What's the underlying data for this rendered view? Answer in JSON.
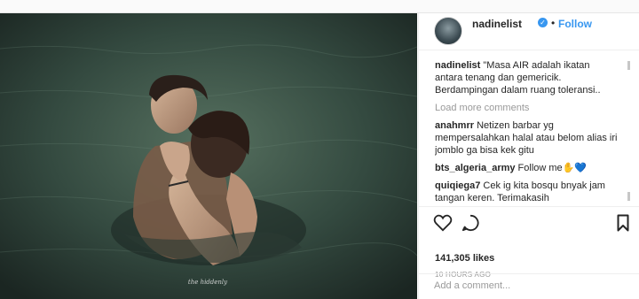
{
  "post": {
    "username": "nadinelist",
    "follow_label": "Follow",
    "separator": "•",
    "verified_icon": "verified-badge-icon",
    "caption_user": "nadinelist",
    "caption_text": " \"Masa AIR adalah ikatan antara tenang dan gemericik. Berdampingan dalam ruang toleransi..",
    "load_more": "Load more comments",
    "comments": [
      {
        "user": "anahmrr",
        "text": " Netizen barbar yg mempersalahkan halal atau belom alias iri jomblo ga bisa kek gitu"
      },
      {
        "user": "bts_algeria_army",
        "text": " Follow me✋💙"
      },
      {
        "user": "quiqiega7",
        "text": " Cek ig kita bosqu bnyak jam tangan keren. Terimakasih"
      }
    ],
    "likes": "141,305 likes",
    "time": "10 HOURS AGO",
    "comment_placeholder": "Add a comment...",
    "photo_watermark": "the hiddenly"
  },
  "icons": {
    "like": "heart-icon",
    "comment": "comment-bubble-icon",
    "save": "bookmark-icon",
    "menu": "more-options-icon"
  },
  "colors": {
    "accent": "#3897f0",
    "text": "#262626",
    "muted": "#999999",
    "water": "#33463d"
  }
}
